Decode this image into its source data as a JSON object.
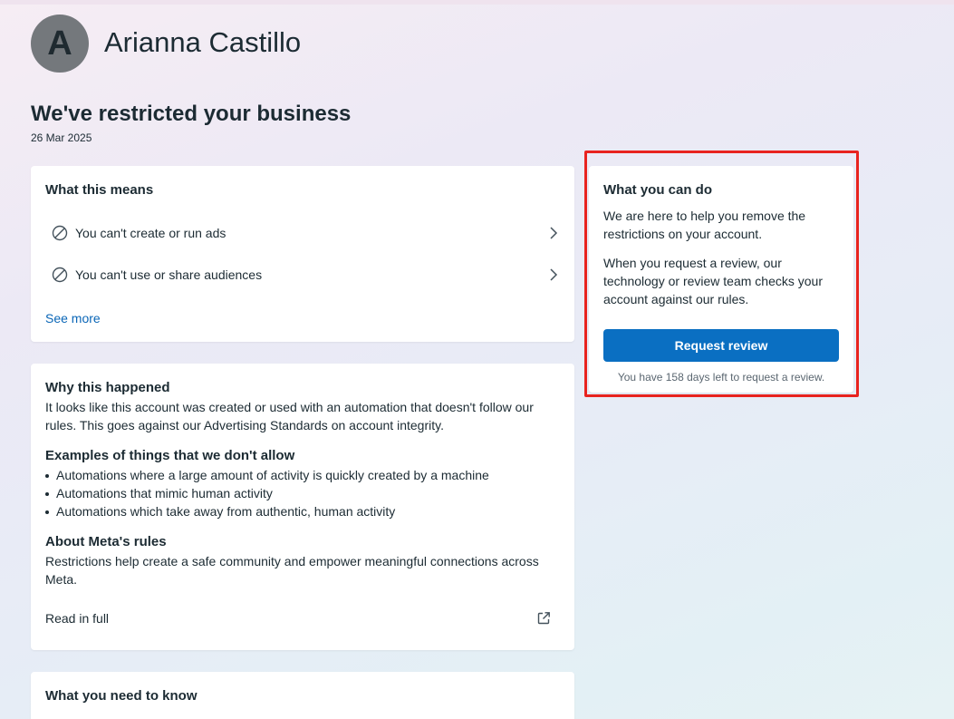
{
  "profile": {
    "avatar_letter": "A",
    "name": "Arianna Castillo"
  },
  "header": {
    "title": "We've restricted your business",
    "date": "26 Mar 2025"
  },
  "what_this_means": {
    "heading": "What this means",
    "items": [
      {
        "label": "You can't create or run ads",
        "icon": "ban-icon"
      },
      {
        "label": "You can't use or share audiences",
        "icon": "ban-icon"
      }
    ],
    "see_more": "See more"
  },
  "why_this_happened": {
    "heading": "Why this happened",
    "body": "It looks like this account was created or used with an automation that doesn't follow our rules. This goes against our Advertising Standards on account integrity.",
    "examples_heading": "Examples of things that we don't allow",
    "examples": [
      "Automations where a large amount of activity is quickly created by a machine",
      "Automations that mimic human activity",
      "Automations which take away from authentic, human activity"
    ],
    "rules_heading": "About Meta's rules",
    "rules_body": "Restrictions help create a safe community and empower meaningful connections across Meta.",
    "read_in_full": "Read in full"
  },
  "what_you_need_to_know": {
    "heading": "What you need to know"
  },
  "what_you_can_do": {
    "heading": "What you can do",
    "para1": "We are here to help you remove the restrictions on your account.",
    "para2": "When you request a review, our technology or review team checks your account against our rules.",
    "button_label": "Request review",
    "days_left_text": "You have 158 days left to request a review."
  },
  "colors": {
    "accent": "#0a6fc2",
    "link": "#0a66b7",
    "highlight_border": "#e8231f"
  }
}
